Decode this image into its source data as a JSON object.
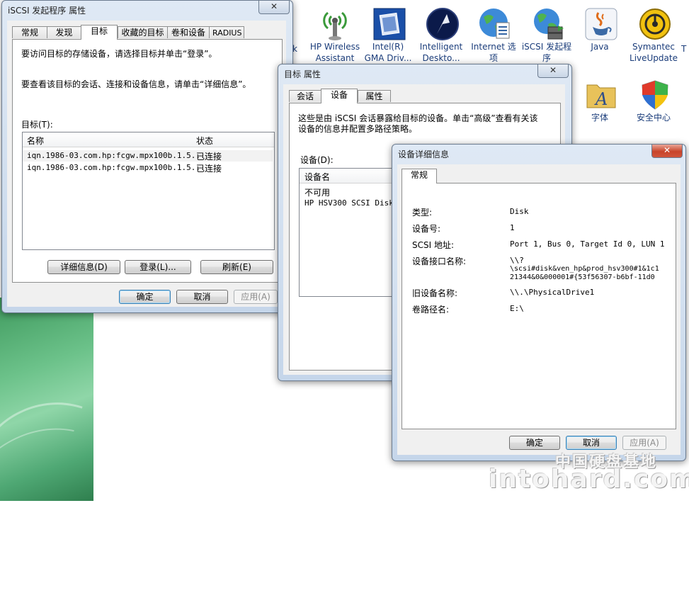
{
  "desktop": {
    "icons": [
      {
        "icon": "hp-wireless-antenna-icon",
        "label1": "HP Wireless",
        "label2": "Assistant"
      },
      {
        "icon": "intel-gma-driver-icon",
        "label1": "Intel(R)",
        "label2": "GMA Driv..."
      },
      {
        "icon": "intelligent-desktop-compass-icon",
        "label1": "Intelligent",
        "label2": "Deskto..."
      },
      {
        "icon": "internet-options-globe-icon",
        "label1": "Internet 选",
        "label2": "项"
      },
      {
        "icon": "iscsi-initiator-globe-icon",
        "label1": "iSCSI 发起程",
        "label2": "序"
      },
      {
        "icon": "java-cup-icon",
        "label1": "Java",
        "label2": ""
      },
      {
        "icon": "symantec-liveupdate-icon",
        "label1": "Symantec",
        "label2": "LiveUpdate"
      },
      {
        "icon": "fonts-folder-icon",
        "label1": "字体",
        "label2": ""
      },
      {
        "icon": "security-center-shield-icon",
        "label1": "安全中心",
        "label2": ""
      }
    ],
    "edge_labels": {
      "left_k": "k",
      "right_t": "T",
      "right_blank": "​"
    }
  },
  "win1": {
    "title": "iSCSI 发起程序 属性",
    "close": "✕",
    "tabs": [
      "常规",
      "发现",
      "目标",
      "收藏的目标",
      "卷和设备",
      "RADIUS"
    ],
    "active_tab": "目标",
    "intro1": "要访问目标的存储设备，请选择目标并单击“登录”。",
    "intro2": "要查看该目标的会话、连接和设备信息，请单击“详细信息”。",
    "targets_label": "目标(T):",
    "columns": {
      "name": "名称",
      "status": "状态"
    },
    "rows": [
      {
        "name": "iqn.1986-03.com.hp:fcgw.mpx100b.1.5...",
        "status": "已连接"
      },
      {
        "name": "iqn.1986-03.com.hp:fcgw.mpx100b.1.5...",
        "status": "已连接"
      }
    ],
    "buttons": {
      "details": "详细信息(D)",
      "login": "登录(L)...",
      "refresh": "刷新(E)"
    },
    "footer": {
      "ok": "确定",
      "cancel": "取消",
      "apply": "应用(A)"
    }
  },
  "win2": {
    "title": "目标 属性",
    "close": "✕",
    "tabs": [
      "会话",
      "设备",
      "属性"
    ],
    "active_tab": "设备",
    "desc1": "这些是由 iSCSI 会话暴露给目标的设备。单击“高级”查看有关该",
    "desc2": "设备的信息并配置多路径策略。",
    "devices_label": "设备(D):",
    "columns": {
      "device_name": "设备名"
    },
    "rows": [
      {
        "name": "不可用"
      },
      {
        "name": "HP HSV300 SCSI Disk D"
      }
    ]
  },
  "win3": {
    "title": "设备详细信息",
    "close": "✕",
    "tabs": [
      "常规"
    ],
    "active_tab": "常规",
    "fields": [
      {
        "label": "类型:",
        "value": "Disk"
      },
      {
        "label": "设备号:",
        "value": "1"
      },
      {
        "label": "SCSI 地址:",
        "value": "Port 1, Bus 0, Target Id 0, LUN 1"
      },
      {
        "label": "设备接口名称:",
        "value": "\\\\?",
        "value2": "\\scsi#disk&ven_hp&prod_hsv300#1&1c1",
        "value3": "21344&0&000001#{53f56307-b6bf-11d0"
      },
      {
        "label": "旧设备名称:",
        "value": "\\\\.\\PhysicalDrive1"
      },
      {
        "label": "卷路径名:",
        "value": "E:\\"
      }
    ],
    "footer": {
      "ok": "确定",
      "cancel": "取消",
      "apply": "应用(A)"
    }
  },
  "watermark": {
    "cn": "中国硬盘基地",
    "en": "intohard.com"
  }
}
